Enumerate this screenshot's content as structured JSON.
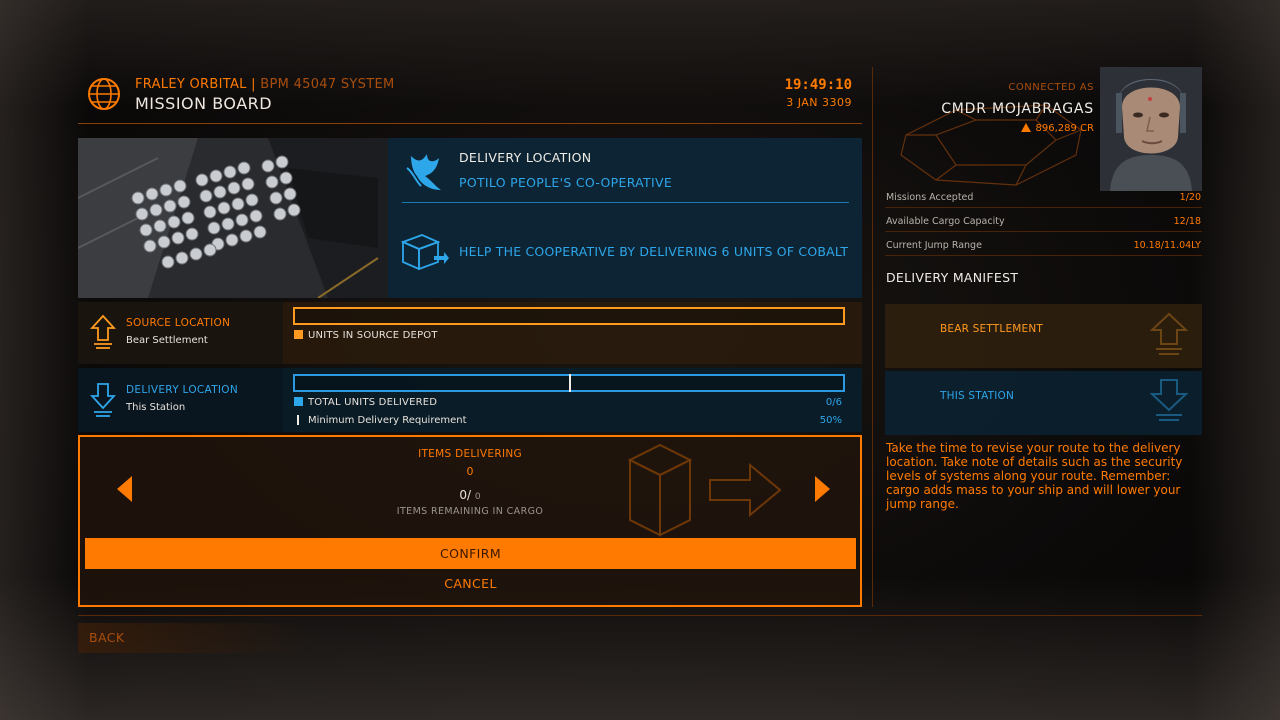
{
  "header": {
    "station": "FRALEY ORBITAL",
    "separator": "|",
    "system": "BPM 45047 SYSTEM",
    "title": "MISSION BOARD",
    "time": "19:49:10",
    "date": "3 JAN 3309"
  },
  "mission": {
    "heading": "DELIVERY LOCATION",
    "faction": "POTILO PEOPLE'S CO-OPERATIVE",
    "objective": "HELP THE COOPERATIVE BY DELIVERING 6 UNITS OF COBALT"
  },
  "source": {
    "label": "SOURCE LOCATION",
    "value": "Bear Settlement",
    "legend": "UNITS IN SOURCE DEPOT"
  },
  "delivery": {
    "label": "DELIVERY LOCATION",
    "value": "This Station",
    "legend": "TOTAL UNITS DELIVERED",
    "count": "0/6",
    "min_label": "Minimum Delivery Requirement",
    "min_pct": "50%",
    "progress_fraction": 0,
    "min_fraction": 0.5
  },
  "deliver_panel": {
    "items_label": "ITEMS DELIVERING",
    "items_count": "0",
    "remaining_value": "0/",
    "remaining_total": "0",
    "remaining_label": "ITEMS REMAINING IN CARGO",
    "confirm": "CONFIRM",
    "cancel": "CANCEL"
  },
  "footer": {
    "back": "BACK"
  },
  "commander": {
    "connected": "CONNECTED AS",
    "name": "CMDR MOJABRAGAS",
    "credits": "896,289 CR"
  },
  "stats": [
    {
      "label": "Missions Accepted",
      "value": "1/20"
    },
    {
      "label": "Available Cargo Capacity",
      "value": "12/18"
    },
    {
      "label": "Current Jump Range",
      "value": "10.18/11.04LY"
    }
  ],
  "manifest": {
    "title": "DELIVERY MANIFEST",
    "source": "BEAR SETTLEMENT",
    "destination": "THIS STATION"
  },
  "tip": "Take the time to revise your route to the delivery location. Take note of details such as the security levels of systems along your route. Remember: cargo adds mass to your ship and will lower your jump range.",
  "colors": {
    "accent": "#ff7a00",
    "blue": "#2ea6ea",
    "text": "#f0ece6"
  }
}
